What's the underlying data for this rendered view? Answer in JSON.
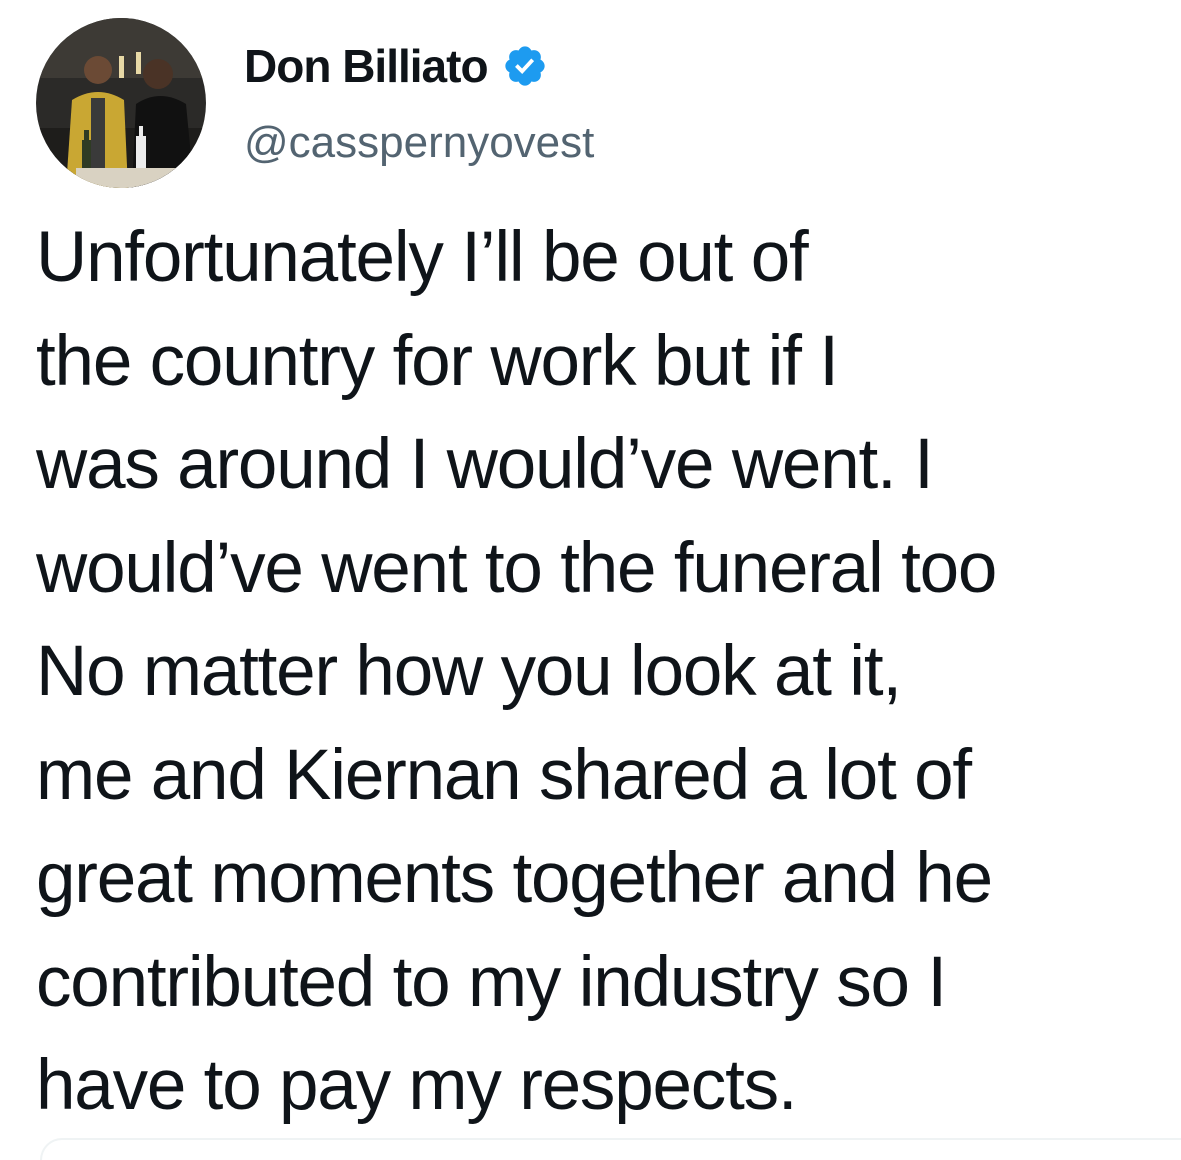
{
  "tweet": {
    "author": {
      "display_name": "Don Billiato",
      "handle": "@casspernyovest",
      "verified": true,
      "avatar_icon": "profile-photo"
    },
    "lines": [
      "Unfortunately I’ll be out of",
      "the country for work but if I",
      "was around I would’ve went. I",
      "would’ve went to the funeral too",
      "No matter how you look at it,",
      "me and Kiernan shared a lot of",
      "great moments together and he",
      "contributed to my industry so I",
      "have to pay my respects."
    ]
  },
  "colors": {
    "text_primary": "#0f1419",
    "text_secondary": "#536471",
    "verified_badge": "#1d9bf0",
    "divider": "#eff3f4"
  }
}
